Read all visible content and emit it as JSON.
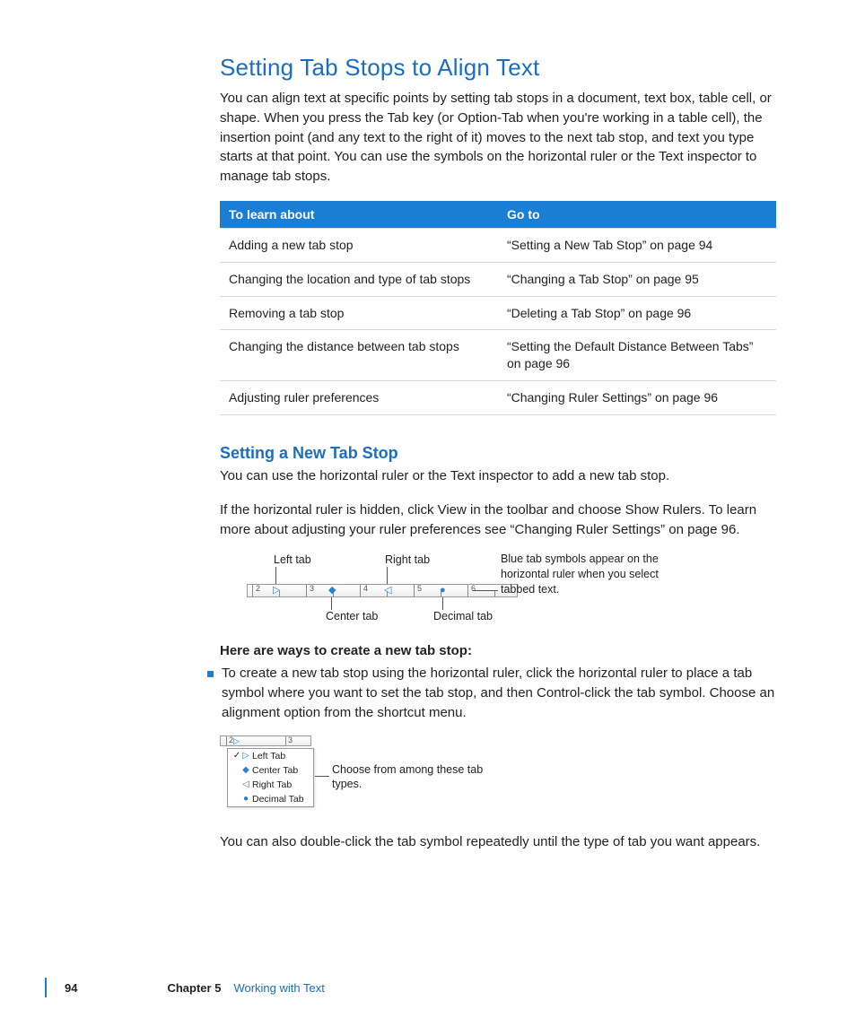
{
  "h1": "Setting Tab Stops to Align Text",
  "intro": "You can align text at specific points by setting tab stops in a document, text box, table cell, or shape. When you press the Tab key (or Option-Tab when you're working in a table cell), the insertion point (and any text to the right of it) moves to the next tab stop, and text you type starts at that point. You can use the symbols on the horizontal ruler or the Text inspector to manage tab stops.",
  "table": {
    "head_left": "To learn about",
    "head_right": "Go to",
    "rows": [
      {
        "l": "Adding a new tab stop",
        "r": "“Setting a New Tab Stop” on page 94"
      },
      {
        "l": "Changing the location and type of tab stops",
        "r": "“Changing a Tab Stop” on page 95"
      },
      {
        "l": "Removing a tab stop",
        "r": "“Deleting a Tab Stop” on page 96"
      },
      {
        "l": "Changing the distance between tab stops",
        "r": "“Setting the Default Distance Between Tabs” on page 96"
      },
      {
        "l": "Adjusting ruler preferences",
        "r": "“Changing Ruler Settings” on page 96"
      }
    ]
  },
  "h2": "Setting a New Tab Stop",
  "p2": "You can use the horizontal ruler or the Text inspector to add a new tab stop.",
  "p3": "If the horizontal ruler is hidden, click View in the toolbar and choose Show Rulers. To learn more about adjusting your ruler preferences see “Changing Ruler Settings” on page 96.",
  "ruler": {
    "left_lbl": "Left tab",
    "right_lbl": "Right tab",
    "center_lbl": "Center tab",
    "decimal_lbl": "Decimal tab",
    "ticks": [
      "2",
      "3",
      "4",
      "5",
      "6"
    ],
    "caption": "Blue tab symbols appear on the horizontal ruler when you select tabbed text."
  },
  "ways": "Here are ways to create a new tab stop:",
  "bullet1": "To create a new tab stop using the horizontal ruler, click the horizontal ruler to place a tab symbol where you want to set the tab stop, and then Control-click the tab symbol. Choose an alignment option from the shortcut menu.",
  "menu": {
    "items": [
      {
        "chk": "✓",
        "icon": "▷",
        "label": "Left Tab",
        "color": "#2a7fd4"
      },
      {
        "chk": "",
        "icon": "◆",
        "label": "Center Tab",
        "color": "#2a7fd4"
      },
      {
        "chk": "",
        "icon": "◁",
        "label": "Right Tab",
        "color": "#2a7fd4"
      },
      {
        "chk": "",
        "icon": "●",
        "label": "Decimal Tab",
        "color": "#2a7fd4"
      }
    ],
    "caption": "Choose from among these tab types."
  },
  "p4": "You can also double-click the tab symbol repeatedly until the type of tab you want appears.",
  "footer": {
    "page": "94",
    "chapter_label": "Chapter 5",
    "chapter_title": "Working with Text"
  }
}
